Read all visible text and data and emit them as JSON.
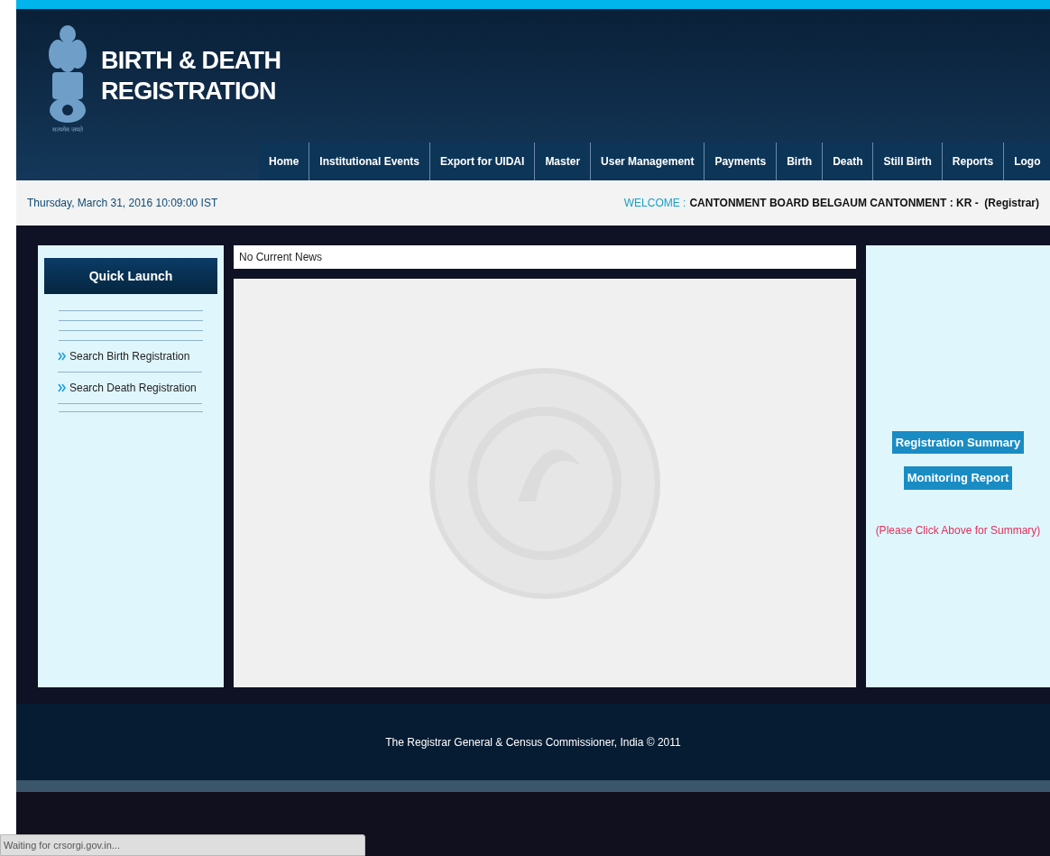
{
  "header": {
    "title_line1": "BIRTH & DEATH",
    "title_line2": "REGISTRATION",
    "emblem_caption": "सत्यमेव जयते"
  },
  "nav": [
    "Home",
    "Institutional Events",
    "Export for UIDAI",
    "Master",
    "User Management",
    "Payments",
    "Birth",
    "Death",
    "Still Birth",
    "Reports",
    "Logo"
  ],
  "date_bar": {
    "date": "Thursday, March 31, 2016 10:09:00 IST",
    "welcome_label": "WELCOME :",
    "welcome_text": "CANTONMENT BOARD BELGAUM CANTONMENT : KR -  (Registrar)"
  },
  "quick_launch": {
    "title": "Quick Launch",
    "items": [
      "Search Birth Registration",
      "Search Death Registration"
    ]
  },
  "news": "No Current News",
  "right_panel": {
    "buttons": [
      "Registration Summary",
      "Monitoring Report"
    ],
    "note": "(Please Click Above for Summary)"
  },
  "footer": "The Registrar General & Census Commissioner, India © 2011",
  "status_bar": "Waiting for crsorgi.gov.in..."
}
